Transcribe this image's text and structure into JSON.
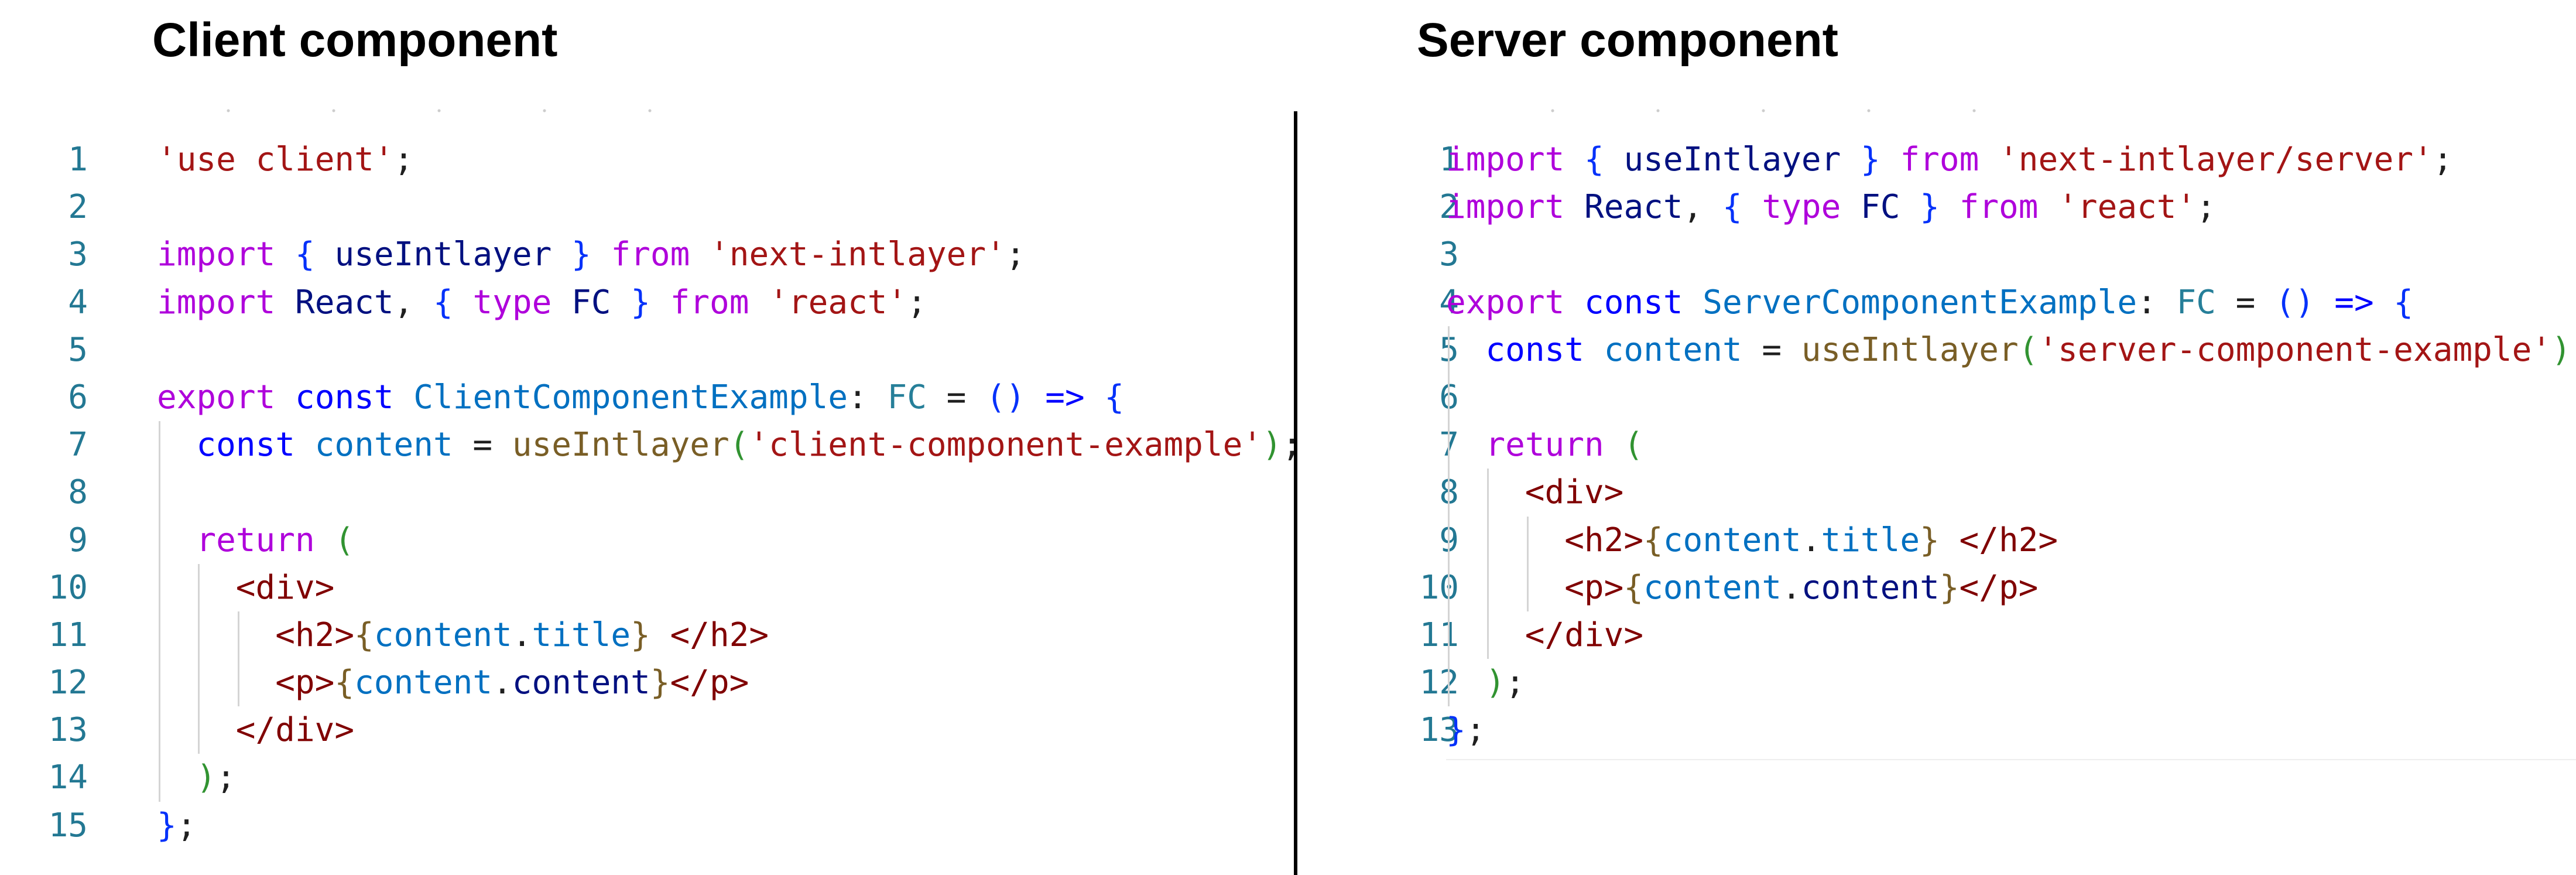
{
  "colors": {
    "keyword_control": "#af00db",
    "keyword": "#0000ff",
    "string": "#a31515",
    "function": "#795e26",
    "type": "#267f99",
    "variable": "#001080",
    "variable_const": "#0070c1",
    "tag": "#800000",
    "punctuation": "#1f1f1f",
    "line_number": "#237893",
    "bracket_blue": "#0431fa",
    "bracket_gold": "#795e26",
    "bracket_purple": "#af00db",
    "bracket_green": "#319331"
  },
  "panels": [
    {
      "id": "client",
      "heading": "Client component",
      "lines": [
        {
          "number": "1",
          "indent": 0,
          "tokens": [
            {
              "text": "'use client'",
              "role": "string"
            },
            {
              "text": ";",
              "role": "punctuation"
            }
          ]
        },
        {
          "number": "2",
          "indent": 0,
          "tokens": []
        },
        {
          "number": "3",
          "indent": 0,
          "tokens": [
            {
              "text": "import",
              "role": "keyword_control"
            },
            {
              "text": " ",
              "role": "punctuation"
            },
            {
              "text": "{",
              "role": "bracket_blue"
            },
            {
              "text": " useIntlayer ",
              "role": "variable"
            },
            {
              "text": "}",
              "role": "bracket_blue"
            },
            {
              "text": " from ",
              "role": "keyword_control"
            },
            {
              "text": "'next-intlayer'",
              "role": "string"
            },
            {
              "text": ";",
              "role": "punctuation"
            }
          ]
        },
        {
          "number": "4",
          "indent": 0,
          "tokens": [
            {
              "text": "import",
              "role": "keyword_control"
            },
            {
              "text": " React",
              "role": "variable"
            },
            {
              "text": ", ",
              "role": "punctuation"
            },
            {
              "text": "{",
              "role": "bracket_blue"
            },
            {
              "text": " type",
              "role": "keyword_control"
            },
            {
              "text": " FC ",
              "role": "variable"
            },
            {
              "text": "}",
              "role": "bracket_blue"
            },
            {
              "text": " from ",
              "role": "keyword_control"
            },
            {
              "text": "'react'",
              "role": "string"
            },
            {
              "text": ";",
              "role": "punctuation"
            }
          ]
        },
        {
          "number": "5",
          "indent": 0,
          "tokens": []
        },
        {
          "number": "6",
          "indent": 0,
          "tokens": [
            {
              "text": "export",
              "role": "keyword_control"
            },
            {
              "text": " const",
              "role": "keyword"
            },
            {
              "text": " ClientComponentExample",
              "role": "variable_const"
            },
            {
              "text": ": ",
              "role": "punctuation"
            },
            {
              "text": "FC",
              "role": "type"
            },
            {
              "text": " = ",
              "role": "punctuation"
            },
            {
              "text": "()",
              "role": "bracket_blue"
            },
            {
              "text": " =>",
              "role": "keyword"
            },
            {
              "text": " ",
              "role": "punctuation"
            },
            {
              "text": "{",
              "role": "bracket_blue"
            }
          ]
        },
        {
          "number": "7",
          "indent": 1,
          "tokens": [
            {
              "text": "const",
              "role": "keyword"
            },
            {
              "text": " content",
              "role": "variable_const"
            },
            {
              "text": " = ",
              "role": "punctuation"
            },
            {
              "text": "useIntlayer",
              "role": "function"
            },
            {
              "text": "(",
              "role": "bracket_green"
            },
            {
              "text": "'client-component-example'",
              "role": "string"
            },
            {
              "text": ")",
              "role": "bracket_green"
            },
            {
              "text": ";",
              "role": "punctuation"
            }
          ]
        },
        {
          "number": "8",
          "indent": 1,
          "tokens": []
        },
        {
          "number": "9",
          "indent": 1,
          "tokens": [
            {
              "text": "return",
              "role": "keyword_control"
            },
            {
              "text": " ",
              "role": "punctuation"
            },
            {
              "text": "(",
              "role": "bracket_green"
            }
          ]
        },
        {
          "number": "10",
          "indent": 2,
          "tokens": [
            {
              "text": "<div>",
              "role": "tag"
            }
          ]
        },
        {
          "number": "11",
          "indent": 3,
          "tokens": [
            {
              "text": "<h2>",
              "role": "tag"
            },
            {
              "text": "{",
              "role": "bracket_gold"
            },
            {
              "text": "content",
              "role": "variable_const"
            },
            {
              "text": ".",
              "role": "punctuation"
            },
            {
              "text": "title",
              "role": "variable_const"
            },
            {
              "text": "}",
              "role": "bracket_gold"
            },
            {
              "text": " ",
              "role": "punctuation"
            },
            {
              "text": "</h2>",
              "role": "tag"
            }
          ]
        },
        {
          "number": "12",
          "indent": 3,
          "tokens": [
            {
              "text": "<p>",
              "role": "tag"
            },
            {
              "text": "{",
              "role": "bracket_gold"
            },
            {
              "text": "content",
              "role": "variable_const"
            },
            {
              "text": ".",
              "role": "punctuation"
            },
            {
              "text": "content",
              "role": "variable"
            },
            {
              "text": "}",
              "role": "bracket_gold"
            },
            {
              "text": "</p>",
              "role": "tag"
            }
          ]
        },
        {
          "number": "13",
          "indent": 2,
          "tokens": [
            {
              "text": "</div>",
              "role": "tag"
            }
          ]
        },
        {
          "number": "14",
          "indent": 1,
          "tokens": [
            {
              "text": ")",
              "role": "bracket_green"
            },
            {
              "text": ";",
              "role": "punctuation"
            }
          ]
        },
        {
          "number": "15",
          "indent": 0,
          "tokens": [
            {
              "text": "}",
              "role": "bracket_blue"
            },
            {
              "text": ";",
              "role": "punctuation"
            }
          ]
        }
      ]
    },
    {
      "id": "server",
      "heading": "Server component",
      "lines": [
        {
          "number": "1",
          "indent": 0,
          "tokens": [
            {
              "text": "import",
              "role": "keyword_control"
            },
            {
              "text": " ",
              "role": "punctuation"
            },
            {
              "text": "{",
              "role": "bracket_blue"
            },
            {
              "text": " useIntlayer ",
              "role": "variable"
            },
            {
              "text": "}",
              "role": "bracket_blue"
            },
            {
              "text": " from ",
              "role": "keyword_control"
            },
            {
              "text": "'next-intlayer/server'",
              "role": "string"
            },
            {
              "text": ";",
              "role": "punctuation"
            }
          ]
        },
        {
          "number": "2",
          "indent": 0,
          "tokens": [
            {
              "text": "import",
              "role": "keyword_control"
            },
            {
              "text": " React",
              "role": "variable"
            },
            {
              "text": ", ",
              "role": "punctuation"
            },
            {
              "text": "{",
              "role": "bracket_blue"
            },
            {
              "text": " type",
              "role": "keyword_control"
            },
            {
              "text": " FC ",
              "role": "variable"
            },
            {
              "text": "}",
              "role": "bracket_blue"
            },
            {
              "text": " from ",
              "role": "keyword_control"
            },
            {
              "text": "'react'",
              "role": "string"
            },
            {
              "text": ";",
              "role": "punctuation"
            }
          ]
        },
        {
          "number": "3",
          "indent": 0,
          "tokens": []
        },
        {
          "number": "4",
          "indent": 0,
          "tokens": [
            {
              "text": "export",
              "role": "keyword_control"
            },
            {
              "text": " const",
              "role": "keyword"
            },
            {
              "text": " ServerComponentExample",
              "role": "variable_const"
            },
            {
              "text": ": ",
              "role": "punctuation"
            },
            {
              "text": "FC",
              "role": "type"
            },
            {
              "text": " = ",
              "role": "punctuation"
            },
            {
              "text": "()",
              "role": "bracket_blue"
            },
            {
              "text": " =>",
              "role": "keyword"
            },
            {
              "text": " ",
              "role": "punctuation"
            },
            {
              "text": "{",
              "role": "bracket_blue"
            }
          ]
        },
        {
          "number": "5",
          "indent": 1,
          "tokens": [
            {
              "text": "const",
              "role": "keyword"
            },
            {
              "text": " content",
              "role": "variable_const"
            },
            {
              "text": " = ",
              "role": "punctuation"
            },
            {
              "text": "useIntlayer",
              "role": "function"
            },
            {
              "text": "(",
              "role": "bracket_green"
            },
            {
              "text": "'server-component-example'",
              "role": "string"
            },
            {
              "text": ")",
              "role": "bracket_green"
            },
            {
              "text": ";",
              "role": "punctuation"
            }
          ]
        },
        {
          "number": "6",
          "indent": 1,
          "tokens": []
        },
        {
          "number": "7",
          "indent": 1,
          "tokens": [
            {
              "text": "return",
              "role": "keyword_control"
            },
            {
              "text": " ",
              "role": "punctuation"
            },
            {
              "text": "(",
              "role": "bracket_green"
            }
          ]
        },
        {
          "number": "8",
          "indent": 2,
          "tokens": [
            {
              "text": "<div>",
              "role": "tag"
            }
          ]
        },
        {
          "number": "9",
          "indent": 3,
          "tokens": [
            {
              "text": "<h2>",
              "role": "tag"
            },
            {
              "text": "{",
              "role": "bracket_gold"
            },
            {
              "text": "content",
              "role": "variable_const"
            },
            {
              "text": ".",
              "role": "punctuation"
            },
            {
              "text": "title",
              "role": "variable_const"
            },
            {
              "text": "}",
              "role": "bracket_gold"
            },
            {
              "text": " ",
              "role": "punctuation"
            },
            {
              "text": "</h2>",
              "role": "tag"
            }
          ]
        },
        {
          "number": "10",
          "indent": 3,
          "tokens": [
            {
              "text": "<p>",
              "role": "tag"
            },
            {
              "text": "{",
              "role": "bracket_gold"
            },
            {
              "text": "content",
              "role": "variable_const"
            },
            {
              "text": ".",
              "role": "punctuation"
            },
            {
              "text": "content",
              "role": "variable"
            },
            {
              "text": "}",
              "role": "bracket_gold"
            },
            {
              "text": "</p>",
              "role": "tag"
            }
          ]
        },
        {
          "number": "11",
          "indent": 2,
          "tokens": [
            {
              "text": "</div>",
              "role": "tag"
            }
          ]
        },
        {
          "number": "12",
          "indent": 1,
          "tokens": [
            {
              "text": ")",
              "role": "bracket_green"
            },
            {
              "text": ";",
              "role": "punctuation"
            }
          ]
        },
        {
          "number": "13",
          "indent": 0,
          "tokens": [
            {
              "text": "}",
              "role": "bracket_blue"
            },
            {
              "text": ";",
              "role": "punctuation"
            }
          ]
        }
      ]
    }
  ]
}
